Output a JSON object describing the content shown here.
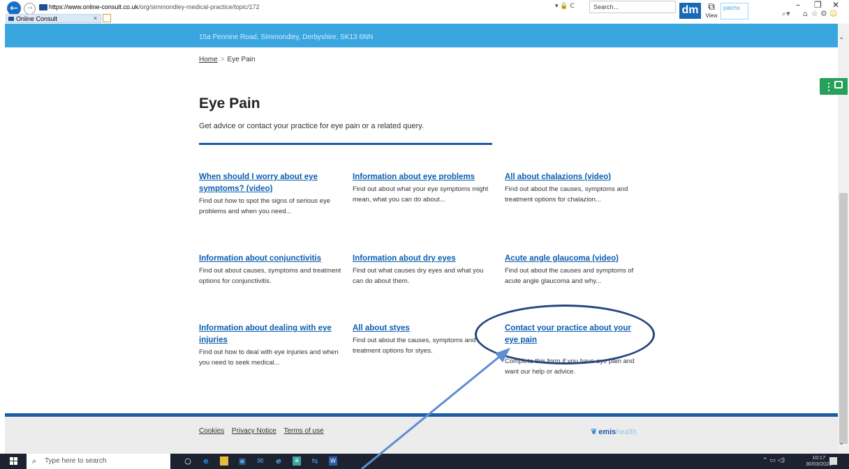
{
  "browser": {
    "url_scheme": "https://www.",
    "url_domain": "online-consult.co.uk",
    "url_path": "/org/simmondley-medical-practice/topic/172",
    "address_tools": "▾ 🔒 C",
    "search_placeholder": "Search...",
    "tab_title": "Online Consult",
    "dm_label": "dm",
    "view_label": "View",
    "patchs_label": "patchs"
  },
  "header": {
    "address": "15a Pennine Road, Simmondley, Derbyshire, SK13 6NN"
  },
  "breadcrumb": {
    "home": "Home",
    "separator": ">",
    "current": "Eye Pain"
  },
  "page": {
    "title": "Eye Pain",
    "intro": "Get advice or contact your practice for eye pain or a related query."
  },
  "cards": [
    {
      "title": "When should I worry about eye symptoms? (video)",
      "desc": "Find out how to spot the signs of serious eye problems and when you need..."
    },
    {
      "title": "Information about eye problems",
      "desc": "Find out about what your eye symptoms might mean, what you can do about..."
    },
    {
      "title": "All about chalazions (video)",
      "desc": "Find out about the causes, symptoms and treatment options for chalazion..."
    },
    {
      "title": "Information about conjunctivitis",
      "desc": "Find out about causes, symptoms and treatment options for conjunctivitis."
    },
    {
      "title": "Information about dry eyes",
      "desc": "Find out what causes dry eyes and what you can do about them."
    },
    {
      "title": "Acute angle glaucoma (video)",
      "desc": "Find out about the causes and symptoms of acute angle glaucoma and why..."
    },
    {
      "title": "Information about dealing with eye injuries",
      "desc": "Find out how to deal with eye injuries and when you need to seek medical..."
    },
    {
      "title": "All about styes",
      "desc": "Find out about the causes, symptoms and treatment options for styes."
    },
    {
      "title": "Contact your practice about your eye pain",
      "desc": "Complete this form if you have eye pain and want our help or advice."
    }
  ],
  "footer": {
    "links": [
      "Cookies",
      "Privacy Notice",
      "Terms of use"
    ],
    "brand_bold": "emis",
    "brand_light": "health"
  },
  "taskbar": {
    "search_placeholder": "Type here to search",
    "time": "10:17",
    "date": "30/03/2021"
  },
  "icons": [
    "back-arrow-icon",
    "forward-arrow-icon",
    "site-icon",
    "lock-icon",
    "refresh-icon",
    "search-icon",
    "home-icon",
    "star-icon",
    "gear-icon",
    "smiley-icon",
    "windows-start-icon",
    "cortana-icon",
    "edge-icon",
    "explorer-icon",
    "store-icon",
    "mail-icon",
    "ie-icon",
    "amazon-icon",
    "word-icon",
    "chat-icon"
  ],
  "colors": {
    "header_band": "#3aa6e0",
    "link": "#0b5eb0",
    "rule": "#1a5ea8",
    "annotation": "#23467e",
    "arrow": "#5b8fd0",
    "widget": "#27a05a"
  }
}
